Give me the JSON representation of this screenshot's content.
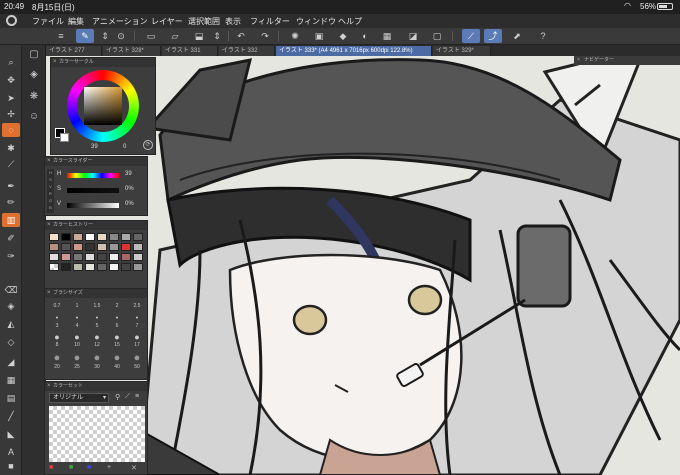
{
  "status": {
    "time": "20:49",
    "date": "8月15日(日)",
    "battery": "56%"
  },
  "menu": [
    "ファイル",
    "編集",
    "アニメーション",
    "レイヤー",
    "選択範囲",
    "表示",
    "フィルター",
    "ウィンドウ",
    "ヘルプ"
  ],
  "tabs": [
    {
      "label": "イラスト 277",
      "active": false
    },
    {
      "label": "イラスト 328*",
      "active": false
    },
    {
      "label": "イラスト 331",
      "active": false
    },
    {
      "label": "イラスト 332",
      "active": false
    },
    {
      "label": "イラスト 333* (A4 4961 x 7016px 600dpi 122.8%)",
      "active": true
    },
    {
      "label": "イラスト 329*",
      "active": false
    }
  ],
  "navigator": {
    "title": "ナビゲーター"
  },
  "color_circle": {
    "title": "カラーサークル",
    "value_s": "39",
    "value_v": "0",
    "mode_hsv": "HSV",
    "mode_rgb": "RGB"
  },
  "color_slider": {
    "title": "カラースライダー",
    "h_label": "H",
    "h_value": "39",
    "s_label": "S",
    "s_value": "0%",
    "v_label": "V",
    "v_value": "0%"
  },
  "color_history": {
    "title": "カラーヒストリー"
  },
  "brush_size": {
    "title": "ブラシサイズ",
    "sizes": [
      "0.7",
      "1",
      "1.5",
      "2",
      "2.5",
      "3",
      "4",
      "5",
      "6",
      "7",
      "8",
      "10",
      "12",
      "15",
      "17",
      "20",
      "25",
      "30",
      "40",
      "50"
    ]
  },
  "color_set": {
    "title": "カラーセット",
    "set_name": "オリジナル"
  },
  "colors": {
    "accent": "#5a7bb5",
    "active_tool": "#e07030",
    "panel": "#3d3d3d"
  }
}
